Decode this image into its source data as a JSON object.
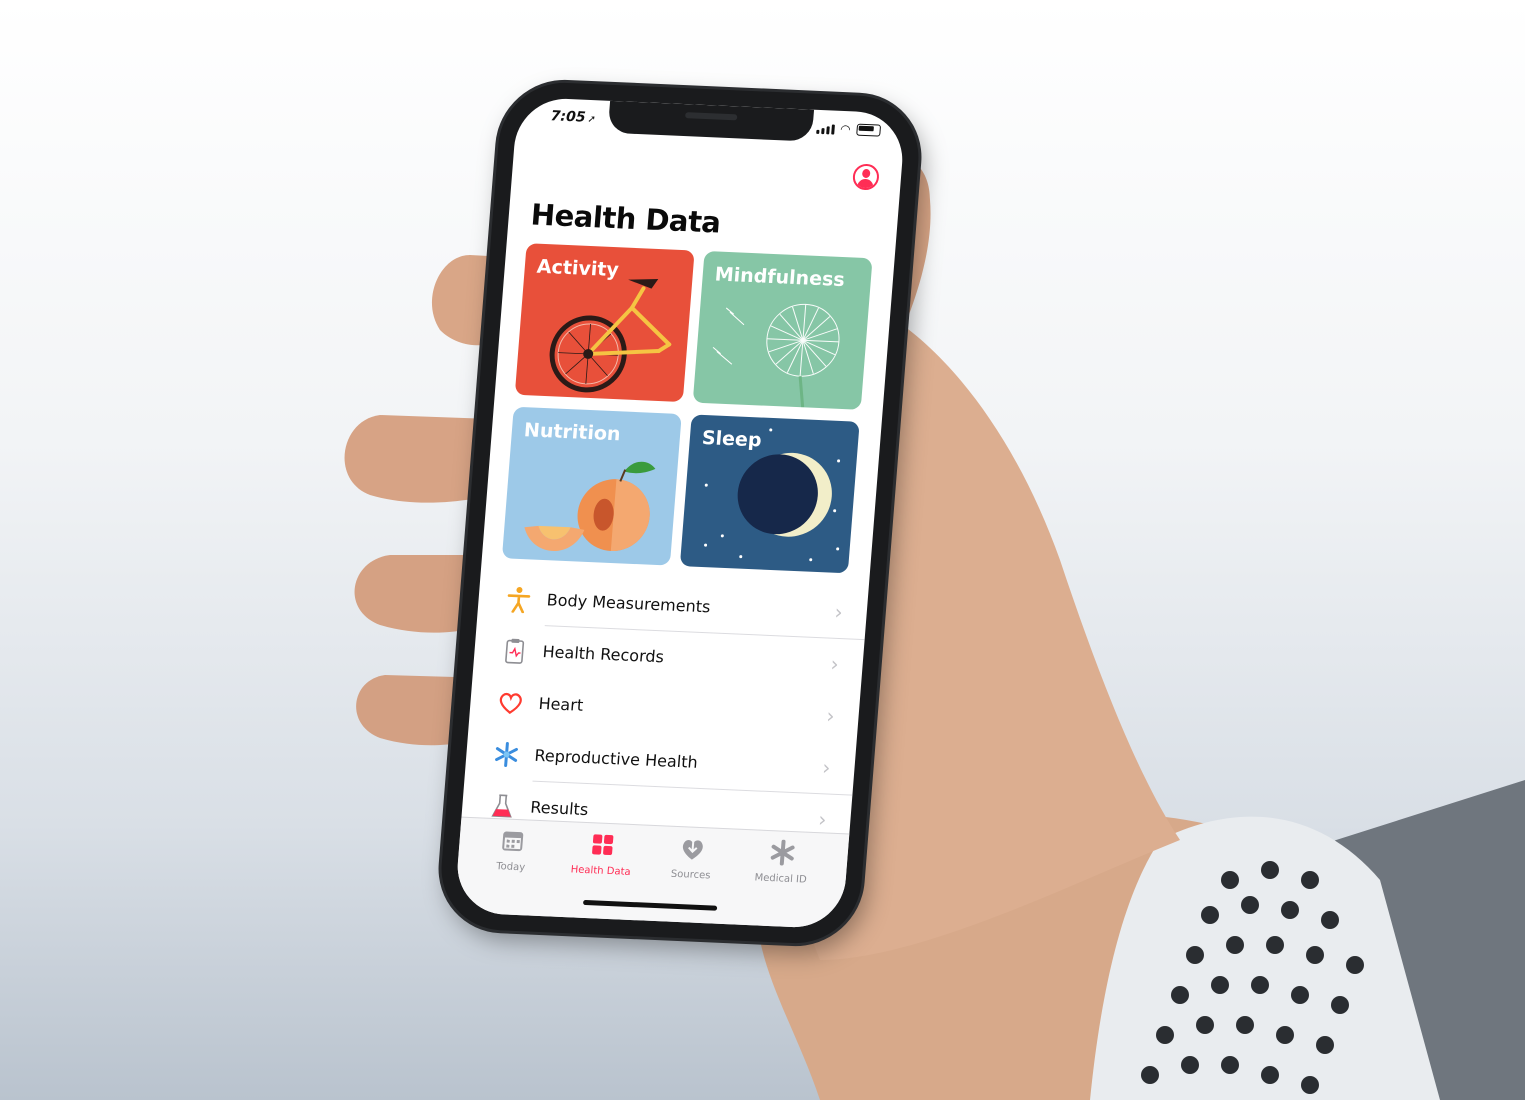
{
  "status_bar": {
    "time": "7:05",
    "location_glyph": "➚"
  },
  "header": {
    "title": "Health Data",
    "profile_icon": "person-circle-icon"
  },
  "categories": [
    {
      "label": "Activity",
      "color": "#e8503a",
      "icon": "bicycle-illustration"
    },
    {
      "label": "Mindfulness",
      "color": "#86c6a6",
      "icon": "dandelion-illustration"
    },
    {
      "label": "Nutrition",
      "color": "#9dc9e8",
      "icon": "peach-illustration"
    },
    {
      "label": "Sleep",
      "color": "#2d5b85",
      "icon": "moon-illustration"
    }
  ],
  "list": [
    {
      "label": "Body Measurements",
      "icon": "figure-icon"
    },
    {
      "label": "Health Records",
      "icon": "clipboard-icon"
    },
    {
      "label": "Heart",
      "icon": "heart-icon"
    },
    {
      "label": "Reproductive Health",
      "icon": "snowflake-icon"
    },
    {
      "label": "Results",
      "icon": "flask-icon"
    }
  ],
  "tabbar": {
    "tabs": [
      {
        "label": "Today",
        "icon": "calendar-icon",
        "active": false
      },
      {
        "label": "Health Data",
        "icon": "grid-icon",
        "active": true
      },
      {
        "label": "Sources",
        "icon": "heart-download-icon",
        "active": false
      },
      {
        "label": "Medical ID",
        "icon": "asterisk-icon",
        "active": false
      }
    ]
  },
  "colors": {
    "accent": "#ff2d55",
    "chevron": "#c4c4c8"
  }
}
